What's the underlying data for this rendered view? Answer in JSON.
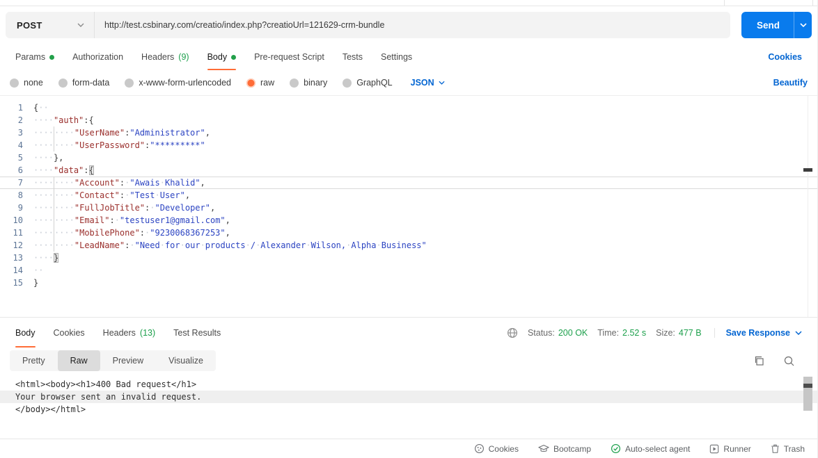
{
  "colors": {
    "accent_orange": "#ff6c37",
    "success_green": "#1da04c",
    "link_blue": "#0265d2",
    "send_blue": "#097bed"
  },
  "request": {
    "method": "POST",
    "url": "http://test.csbinary.com/creatio/index.php?creatioUrl=121629-crm-bundle",
    "send_label": "Send"
  },
  "request_tabs": {
    "items": [
      {
        "label": "Params",
        "dot": true
      },
      {
        "label": "Authorization"
      },
      {
        "label": "Headers",
        "count": "(9)"
      },
      {
        "label": "Body",
        "dot": true,
        "active": true
      },
      {
        "label": "Pre-request Script"
      },
      {
        "label": "Tests"
      },
      {
        "label": "Settings"
      }
    ],
    "cookies_link": "Cookies"
  },
  "body_types": {
    "options": [
      {
        "label": "none"
      },
      {
        "label": "form-data"
      },
      {
        "label": "x-www-form-urlencoded"
      },
      {
        "label": "raw",
        "selected": true
      },
      {
        "label": "binary"
      },
      {
        "label": "GraphQL"
      }
    ],
    "format": "JSON",
    "beautify_link": "Beautify"
  },
  "editor": {
    "lines": [
      {
        "n": "1",
        "tokens": [
          {
            "c": "punc",
            "t": "{"
          },
          {
            "c": "ws",
            "t": "  "
          }
        ]
      },
      {
        "n": "2",
        "tokens": [
          {
            "c": "ws",
            "t": "    "
          },
          {
            "c": "key",
            "t": "\"auth\""
          },
          {
            "c": "punc",
            "t": ":{"
          }
        ]
      },
      {
        "n": "3",
        "tokens": [
          {
            "c": "ws",
            "t": "    "
          },
          {
            "c": "guide",
            "t": ""
          },
          {
            "c": "ws",
            "t": "    "
          },
          {
            "c": "key",
            "t": "\"UserName\""
          },
          {
            "c": "punc",
            "t": ":"
          },
          {
            "c": "str",
            "t": "\"Administrator\""
          },
          {
            "c": "punc",
            "t": ","
          }
        ]
      },
      {
        "n": "4",
        "tokens": [
          {
            "c": "ws",
            "t": "    "
          },
          {
            "c": "guide",
            "t": ""
          },
          {
            "c": "ws",
            "t": "    "
          },
          {
            "c": "key",
            "t": "\"UserPassword\""
          },
          {
            "c": "punc",
            "t": ":"
          },
          {
            "c": "str",
            "t": "\"*********\""
          }
        ]
      },
      {
        "n": "5",
        "tokens": [
          {
            "c": "ws",
            "t": "    "
          },
          {
            "c": "punc",
            "t": "},"
          }
        ]
      },
      {
        "n": "6",
        "tokens": [
          {
            "c": "ws",
            "t": "    "
          },
          {
            "c": "key",
            "t": "\"data\""
          },
          {
            "c": "punc",
            "t": ":"
          },
          {
            "c": "bm",
            "t": "{"
          }
        ]
      },
      {
        "n": "7",
        "active": true,
        "tokens": [
          {
            "c": "ws",
            "t": "    "
          },
          {
            "c": "guide",
            "t": ""
          },
          {
            "c": "ws",
            "t": "    "
          },
          {
            "c": "key",
            "t": "\"Account\""
          },
          {
            "c": "punc",
            "t": ":"
          },
          {
            "c": "ws",
            "t": " "
          },
          {
            "c": "str",
            "t": "\"Awais Khalid\""
          },
          {
            "c": "punc",
            "t": ","
          }
        ]
      },
      {
        "n": "8",
        "tokens": [
          {
            "c": "ws",
            "t": "    "
          },
          {
            "c": "guide",
            "t": ""
          },
          {
            "c": "ws",
            "t": "    "
          },
          {
            "c": "key",
            "t": "\"Contact\""
          },
          {
            "c": "punc",
            "t": ":"
          },
          {
            "c": "ws",
            "t": " "
          },
          {
            "c": "str",
            "t": "\"Test User\""
          },
          {
            "c": "punc",
            "t": ","
          }
        ]
      },
      {
        "n": "9",
        "tokens": [
          {
            "c": "ws",
            "t": "    "
          },
          {
            "c": "guide",
            "t": ""
          },
          {
            "c": "ws",
            "t": "    "
          },
          {
            "c": "key",
            "t": "\"FullJobTitle\""
          },
          {
            "c": "punc",
            "t": ":"
          },
          {
            "c": "ws",
            "t": " "
          },
          {
            "c": "str",
            "t": "\"Developer\""
          },
          {
            "c": "punc",
            "t": ","
          }
        ]
      },
      {
        "n": "10",
        "tokens": [
          {
            "c": "ws",
            "t": "    "
          },
          {
            "c": "guide",
            "t": ""
          },
          {
            "c": "ws",
            "t": "    "
          },
          {
            "c": "key",
            "t": "\"Email\""
          },
          {
            "c": "punc",
            "t": ":"
          },
          {
            "c": "ws",
            "t": " "
          },
          {
            "c": "str",
            "t": "\"testuser1@gmail.com\""
          },
          {
            "c": "punc",
            "t": ","
          }
        ]
      },
      {
        "n": "11",
        "tokens": [
          {
            "c": "ws",
            "t": "    "
          },
          {
            "c": "guide",
            "t": ""
          },
          {
            "c": "ws",
            "t": "    "
          },
          {
            "c": "key",
            "t": "\"MobilePhone\""
          },
          {
            "c": "punc",
            "t": ":"
          },
          {
            "c": "ws",
            "t": " "
          },
          {
            "c": "str",
            "t": "\"9230068367253\""
          },
          {
            "c": "punc",
            "t": ","
          }
        ]
      },
      {
        "n": "12",
        "tokens": [
          {
            "c": "ws",
            "t": "    "
          },
          {
            "c": "guide",
            "t": ""
          },
          {
            "c": "ws",
            "t": "    "
          },
          {
            "c": "key",
            "t": "\"LeadName\""
          },
          {
            "c": "punc",
            "t": ":"
          },
          {
            "c": "ws",
            "t": " "
          },
          {
            "c": "str",
            "t": "\"Need for our products / Alexander Wilson, Alpha Business\""
          }
        ]
      },
      {
        "n": "13",
        "tokens": [
          {
            "c": "ws",
            "t": "    "
          },
          {
            "c": "bm",
            "t": "}"
          }
        ]
      },
      {
        "n": "14",
        "tokens": [
          {
            "c": "ws",
            "t": "  "
          }
        ]
      },
      {
        "n": "15",
        "tokens": [
          {
            "c": "punc",
            "t": "}"
          }
        ]
      }
    ]
  },
  "response": {
    "tabs": [
      {
        "label": "Body",
        "active": true
      },
      {
        "label": "Cookies"
      },
      {
        "label": "Headers",
        "count": "(13)"
      },
      {
        "label": "Test Results"
      }
    ],
    "meta": {
      "status_label": "Status:",
      "status_value": "200 OK",
      "time_label": "Time:",
      "time_value": "2.52 s",
      "size_label": "Size:",
      "size_value": "477 B",
      "save_label": "Save Response"
    },
    "view_modes": [
      {
        "label": "Pretty"
      },
      {
        "label": "Raw",
        "selected": true
      },
      {
        "label": "Preview"
      },
      {
        "label": "Visualize"
      }
    ],
    "body_lines": [
      "<html><body><h1>400 Bad request</h1>",
      "Your browser sent an invalid request.",
      "</body></html>"
    ],
    "highlight_index": 1
  },
  "footer": {
    "items": [
      {
        "label": "Cookies",
        "icon": "cookie-icon"
      },
      {
        "label": "Bootcamp",
        "icon": "bootcamp-icon"
      },
      {
        "label": "Auto-select agent",
        "icon": "auto-select-check-icon"
      },
      {
        "label": "Runner",
        "icon": "runner-icon"
      },
      {
        "label": "Trash",
        "icon": "trash-icon"
      }
    ]
  }
}
